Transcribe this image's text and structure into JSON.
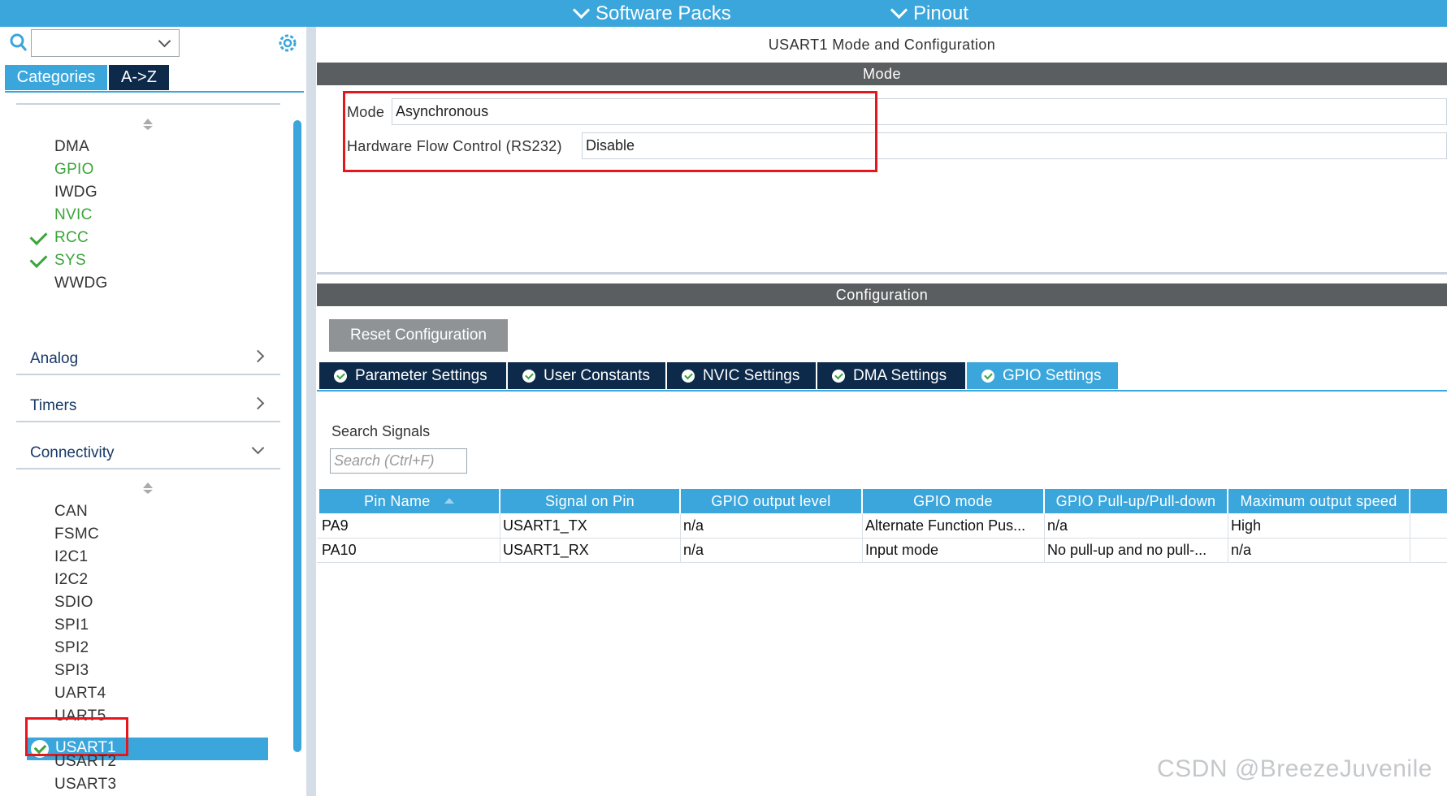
{
  "topbar": {
    "menus": [
      "Software Packs",
      "Pinout"
    ]
  },
  "left": {
    "tabs": [
      "Categories",
      "A->Z"
    ],
    "system_items": [
      "DMA",
      "GPIO",
      "IWDG",
      "NVIC",
      "RCC",
      "SYS",
      "WWDG"
    ],
    "categories": [
      "Analog",
      "Timers",
      "Connectivity"
    ],
    "connectivity_items": [
      "CAN",
      "FSMC",
      "I2C1",
      "I2C2",
      "SDIO",
      "SPI1",
      "SPI2",
      "SPI3",
      "UART4",
      "UART5",
      "USART1",
      "USART2",
      "USART3"
    ]
  },
  "right": {
    "title": "USART1 Mode and Configuration",
    "mode_header": "Mode",
    "mode_label": "Mode",
    "mode_value": "Asynchronous",
    "flow_label": "Hardware Flow Control (RS232)",
    "flow_value": "Disable",
    "config_header": "Configuration",
    "reset_button": "Reset Configuration",
    "tabs": [
      "Parameter Settings",
      "User Constants",
      "NVIC Settings",
      "DMA Settings",
      "GPIO Settings"
    ],
    "search_label": "Search Signals",
    "search_placeholder": "Search (Ctrl+F)",
    "table": {
      "headers": [
        "Pin Name",
        "Signal on Pin",
        "GPIO output level",
        "GPIO mode",
        "GPIO Pull-up/Pull-down",
        "Maximum output speed"
      ],
      "rows": [
        [
          "PA9",
          "USART1_TX",
          "n/a",
          "Alternate Function Pus...",
          "n/a",
          "High"
        ],
        [
          "PA10",
          "USART1_RX",
          "n/a",
          "Input mode",
          "No pull-up and no pull-...",
          "n/a"
        ]
      ]
    }
  },
  "watermark": "CSDN @BreezeJuvenile",
  "colors": {
    "accent": "#3ba6db",
    "dark_tab": "#0d2a4a",
    "green": "#3aa53a",
    "highlight_red": "#e6161d",
    "band_grey": "#5b5e60"
  }
}
